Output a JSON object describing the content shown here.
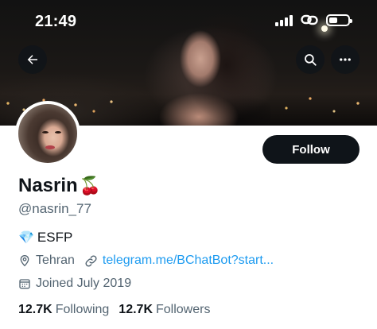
{
  "status_bar": {
    "time": "21:49"
  },
  "header": {
    "back_icon": "arrow-left-icon",
    "search_icon": "search-icon",
    "more_icon": "more-horizontal-icon"
  },
  "profile": {
    "display_name": "Nasrin",
    "name_emoji": "🍒",
    "handle": "@nasrin_77",
    "follow_label": "Follow",
    "bio_emoji": "💎",
    "bio_text": "ESFP",
    "location": "Tehran",
    "website": "telegram.me/BChatBot?start...",
    "joined": "Joined July 2019",
    "following_count": "12.7K",
    "following_label": "Following",
    "followers_count": "12.7K",
    "followers_label": "Followers"
  },
  "colors": {
    "accent_link": "#1d9bf0",
    "primary_text": "#0f1419",
    "secondary_text": "#536471",
    "follow_bg": "#0f1419"
  }
}
